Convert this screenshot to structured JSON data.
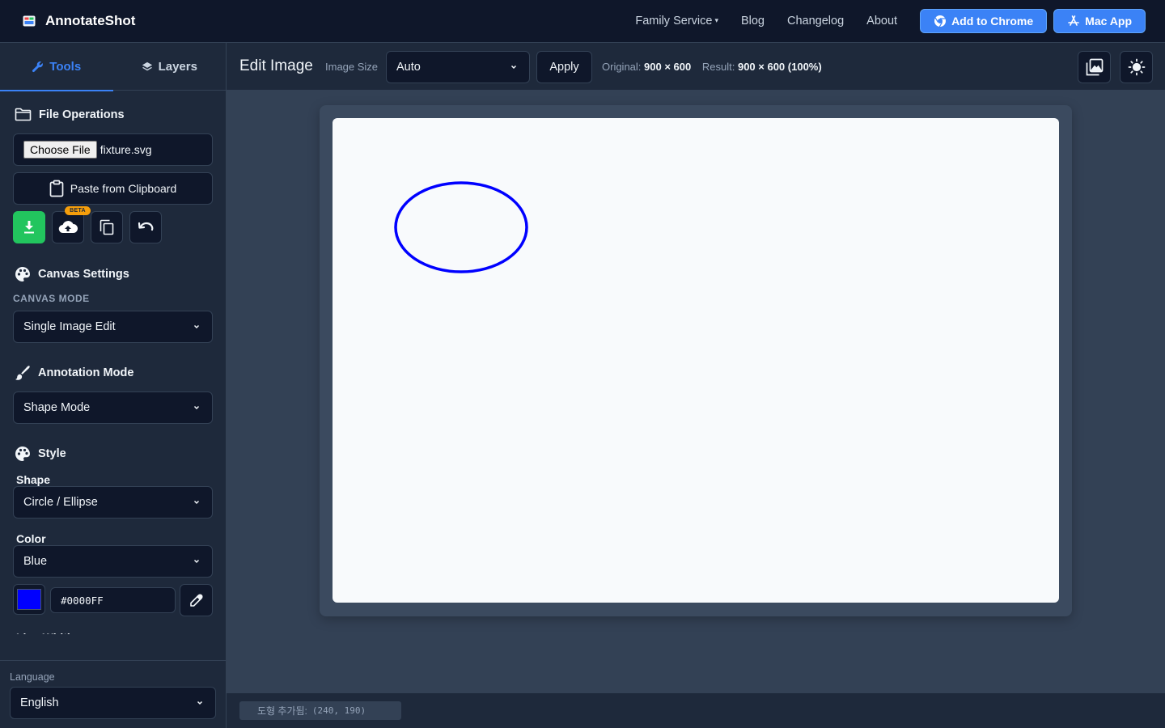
{
  "app": {
    "name": "AnnotateShot",
    "nav": {
      "family_service": "Family Service",
      "blog": "Blog",
      "changelog": "Changelog",
      "about": "About",
      "add_to_chrome": "Add to Chrome",
      "mac_app": "Mac App"
    }
  },
  "sidebar": {
    "tabs": {
      "tools": "Tools",
      "layers": "Layers"
    },
    "file_operations": {
      "title": "File Operations",
      "choose_file": "Choose File",
      "file_name": "fixture.svg",
      "paste": "Paste from Clipboard",
      "beta_badge": "BETA"
    },
    "canvas_settings": {
      "title": "Canvas Settings",
      "mode_label": "CANVAS MODE",
      "mode_value": "Single Image Edit"
    },
    "annotation_mode": {
      "title": "Annotation Mode",
      "value": "Shape Mode"
    },
    "style": {
      "title": "Style",
      "shape_label": "Shape",
      "shape_value": "Circle / Ellipse",
      "color_label": "Color",
      "color_value": "Blue",
      "hex_value": "#0000FF",
      "next_label_cutoff": "Line Width"
    },
    "language": {
      "label": "Language",
      "value": "English"
    }
  },
  "editor": {
    "title": "Edit Image",
    "image_size_label": "Image Size",
    "image_size_value": "Auto",
    "apply": "Apply",
    "original_label": "Original:",
    "original_value": "900 × 600",
    "result_label": "Result:",
    "result_value": "900 × 600 (100%)"
  },
  "canvas": {
    "background": "#f8fafc",
    "shapes": [
      {
        "type": "ellipse",
        "stroke": "#0000FF"
      }
    ]
  },
  "status": {
    "message": "도형 추가됨:",
    "coords": "(240, 190)"
  },
  "colors": {
    "accent": "#3b82f6",
    "download_green": "#22c55e",
    "beta_amber": "#f59e0b",
    "selected_color": "#0000FF"
  }
}
